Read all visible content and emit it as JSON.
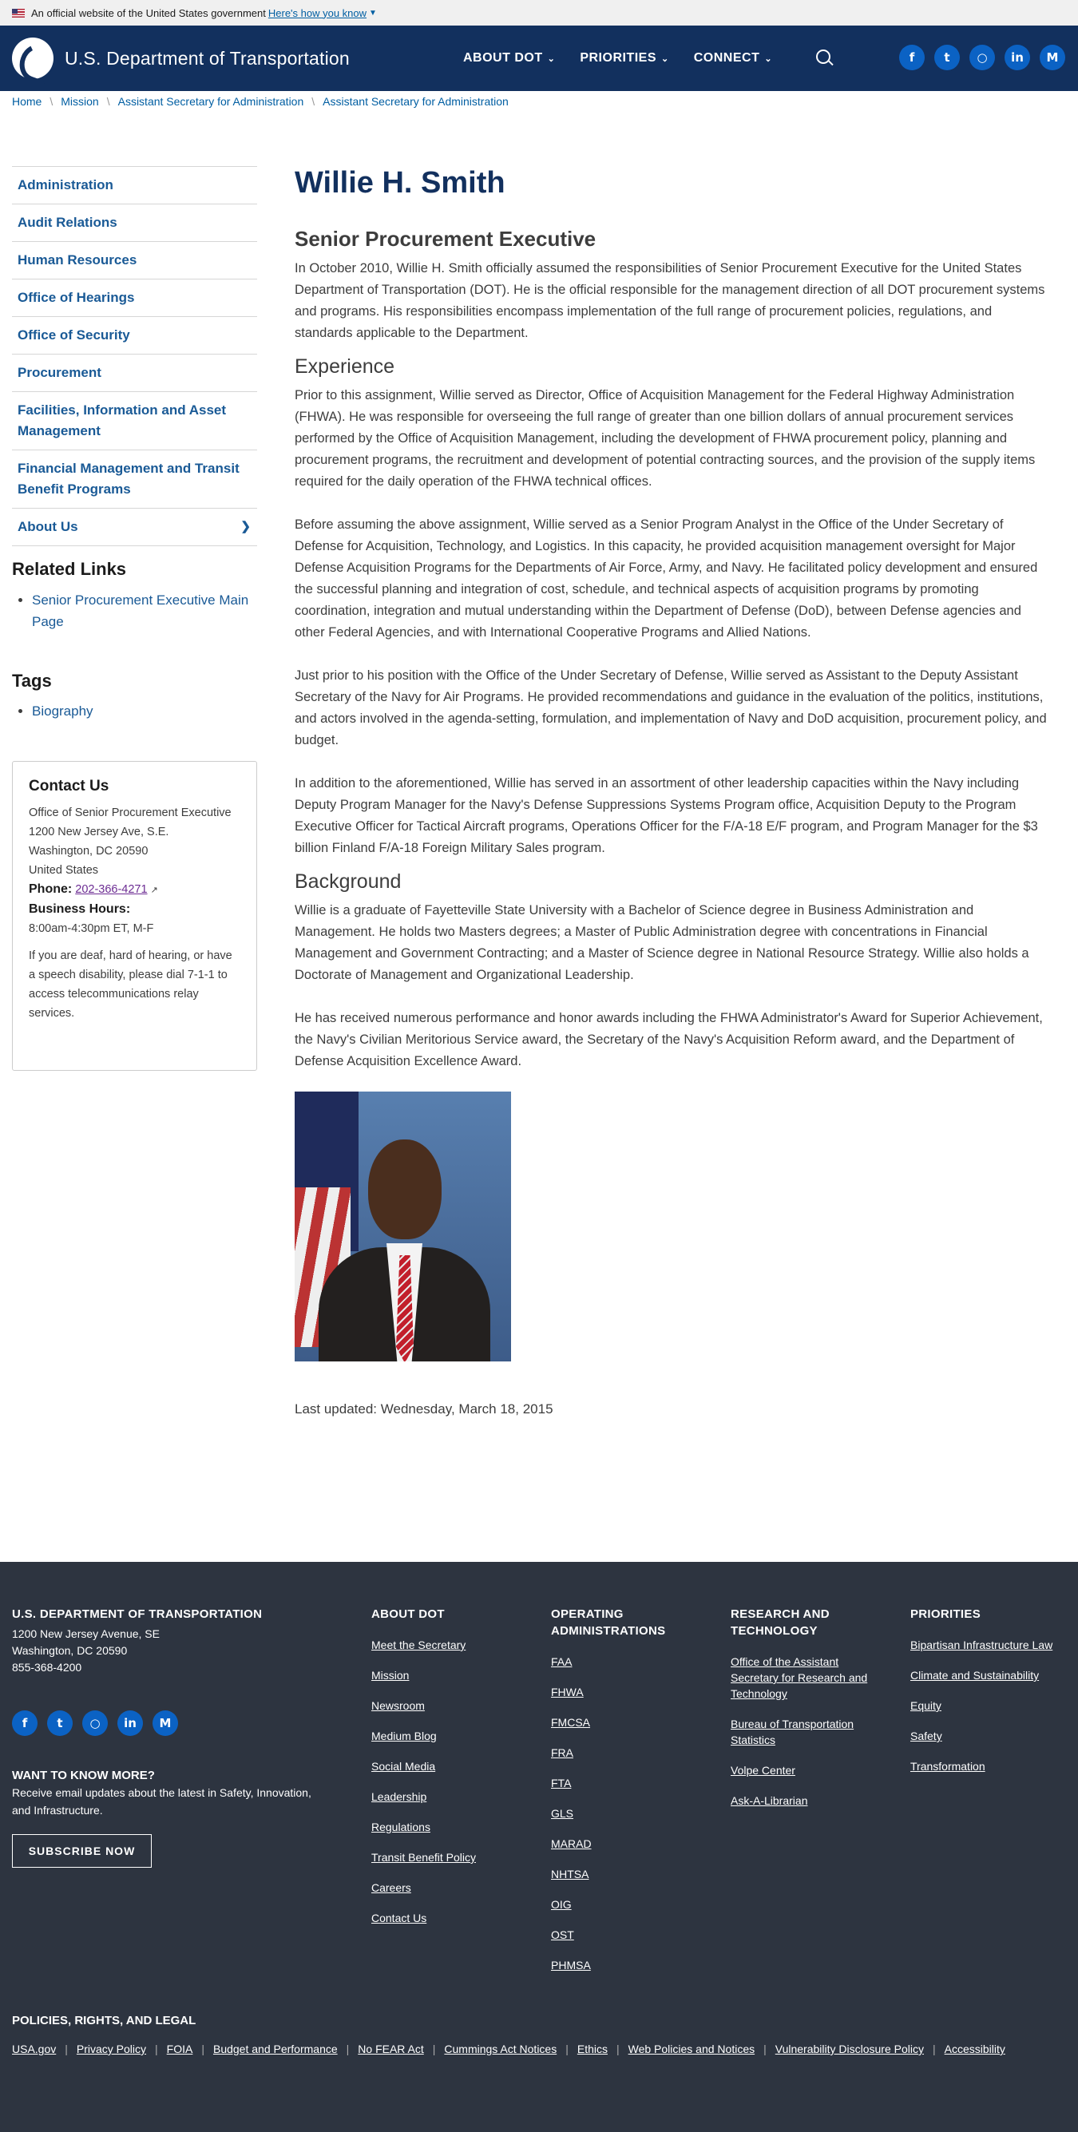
{
  "gov_banner": {
    "text": "An official website of the United States government",
    "link": "Here's how you know"
  },
  "header": {
    "site_title": "U.S. Department of Transportation",
    "nav": [
      "ABOUT DOT",
      "PRIORITIES",
      "CONNECT"
    ],
    "social": [
      "f",
      "t",
      "ig",
      "in",
      "M"
    ]
  },
  "breadcrumb": [
    "Home",
    "Mission",
    "Assistant Secretary for Administration",
    "Assistant Secretary for Administration"
  ],
  "sidebar": {
    "items": [
      "Administration",
      "Audit Relations",
      "Human Resources",
      "Office of Hearings",
      "Office of Security",
      "Procurement",
      "Facilities, Information and Asset Management",
      "Financial Management and Transit Benefit Programs",
      "About Us"
    ],
    "related_heading": "Related Links",
    "related_links": [
      "Senior Procurement Executive Main Page"
    ],
    "tags_heading": "Tags",
    "tags": [
      "Biography"
    ]
  },
  "contact": {
    "heading": "Contact Us",
    "address": [
      "Office of Senior Procurement Executive",
      "1200 New Jersey Ave, S.E.",
      "Washington, DC 20590",
      "United States"
    ],
    "phone_label": "Phone:",
    "phone": "202-366-4271",
    "hours_label": "Business Hours:",
    "hours": "8:00am-4:30pm ET, M-F",
    "note": "If you are deaf, hard of hearing, or have a speech disability, please dial 7-1-1 to access telecommunications relay services."
  },
  "main": {
    "title": "Willie H. Smith",
    "subtitle": "Senior Procurement Executive",
    "intro": "In October 2010, Willie H. Smith officially assumed the responsibilities of Senior Procurement Executive for the United States Department of Transportation (DOT). He is the official responsible for the management direction of all DOT procurement systems and programs. His responsibilities encompass implementation of the full range of procurement policies, regulations, and standards applicable to the Department.",
    "experience_heading": "Experience",
    "experience": [
      "Prior to this assignment, Willie served as Director, Office of Acquisition Management for the Federal Highway Administration (FHWA).  He was responsible for overseeing the full range of greater than one billion dollars of annual procurement services performed by the Office of Acquisition Management, including the development of FHWA procurement policy, planning and procurement programs, the recruitment and development of potential contracting sources, and the provision of the supply items required for the daily operation of the FHWA technical offices.",
      "Before assuming the above assignment, Willie served as a Senior Program Analyst in the Office of the Under Secretary of Defense for Acquisition, Technology, and Logistics.  In this capacity, he provided acquisition management oversight for Major Defense Acquisition Programs for the Departments of Air Force, Army, and Navy.  He facilitated policy development and ensured the successful planning and integration of cost, schedule, and technical aspects of acquisition programs by promoting coordination, integration and mutual understanding within the Department of Defense (DoD), between Defense agencies and other Federal Agencies, and with International Cooperative Programs and Allied Nations.",
      "Just prior to his position with the Office of the Under Secretary of Defense, Willie served as Assistant to the Deputy Assistant Secretary of the Navy for Air Programs.  He provided recommendations and guidance in the evaluation of the politics, institutions, and actors involved in the agenda-setting, formulation, and implementation of Navy and DoD acquisition, procurement policy, and budget.",
      "In addition to the aforementioned, Willie has served in an assortment of other leadership capacities within the Navy including Deputy Program Manager for the Navy's Defense Suppressions Systems Program office, Acquisition Deputy to the Program Executive Officer for Tactical Aircraft programs,  Operations Officer for the F/A-18 E/F program, and Program Manager for the $3 billion Finland F/A-18 Foreign Military Sales program."
    ],
    "background_heading": "Background",
    "background": [
      "Willie is a graduate of Fayetteville State University with a Bachelor of Science degree in Business Administration and Management.  He holds two Masters degrees; a Master  of Public Administration degree with concentrations in Financial Management and Government Contracting; and a Master  of Science degree in National Resource Strategy.  Willie also holds a Doctorate of Management and Organizational Leadership.",
      "He has received numerous performance and honor awards including the FHWA Administrator's Award for Superior Achievement, the Navy's Civilian Meritorious Service award, the Secretary of the Navy's Acquisition Reform award, and the Department of Defense Acquisition Excellence Award."
    ],
    "last_updated": "Last updated: Wednesday, March 18, 2015"
  },
  "footer": {
    "org": "U.S. DEPARTMENT OF TRANSPORTATION",
    "address": [
      "1200 New Jersey Avenue, SE",
      "Washington, DC 20590",
      "855-368-4200"
    ],
    "want_heading": "WANT TO KNOW MORE?",
    "want_text": "Receive email updates about the latest in Safety, Innovation, and Infrastructure.",
    "subscribe": "SUBSCRIBE NOW",
    "columns": [
      {
        "heading": "ABOUT DOT",
        "links": [
          "Meet the Secretary",
          "Mission",
          "Newsroom",
          "Medium Blog",
          "Social Media",
          "Leadership",
          "Regulations",
          "Transit Benefit Policy",
          "Careers",
          "Contact Us"
        ]
      },
      {
        "heading": "OPERATING ADMINISTRATIONS",
        "links": [
          "FAA",
          "FHWA",
          "FMCSA",
          "FRA",
          "FTA",
          "GLS",
          "MARAD",
          "NHTSA",
          "OIG",
          "OST",
          "PHMSA"
        ]
      },
      {
        "heading": "RESEARCH AND TECHNOLOGY",
        "links": [
          "Office of the Assistant Secretary for Research and Technology",
          "Bureau of Transportation Statistics",
          "Volpe Center",
          "Ask-A-Librarian"
        ]
      },
      {
        "heading": "PRIORITIES",
        "links": [
          "Bipartisan Infrastructure Law",
          "Climate and Sustainability",
          "Equity",
          "Safety",
          "Transformation"
        ]
      }
    ],
    "policies_heading": "POLICIES, RIGHTS, AND LEGAL",
    "policy_links": [
      "USA.gov",
      "Privacy Policy",
      "FOIA",
      "Budget and Performance",
      "No FEAR Act",
      "Cummings Act Notices",
      "Ethics",
      "Web Policies and Notices",
      "Vulnerability Disclosure Policy",
      "Accessibility"
    ]
  }
}
